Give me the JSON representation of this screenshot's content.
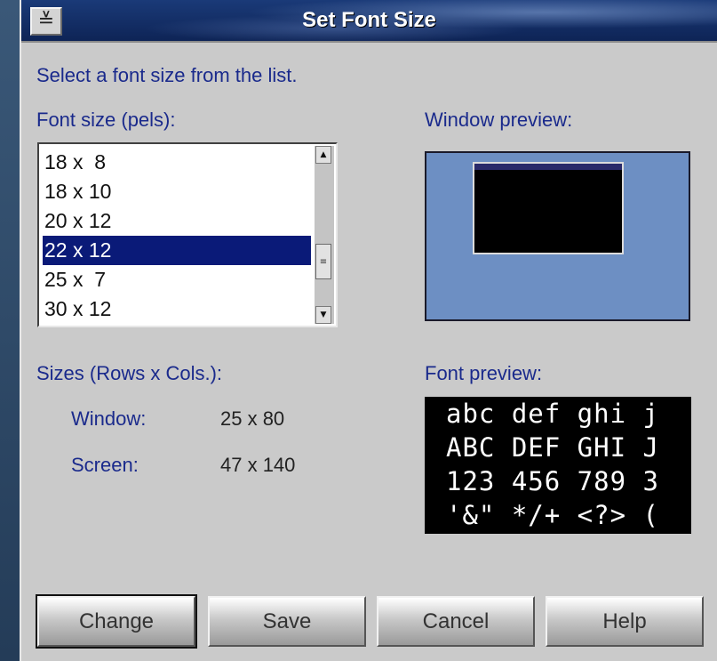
{
  "window": {
    "title": "Set Font Size",
    "sysmenu_glyph": "≚"
  },
  "instruction": "Select a font size from the list.",
  "font_size": {
    "label": "Font size (pels):",
    "items": [
      "18 x  8",
      "18 x 10",
      "20 x 12",
      "22 x 12",
      "25 x  7",
      "30 x 12"
    ],
    "selected": "22 x 12"
  },
  "window_preview": {
    "label": "Window preview:",
    "background_color": "#6d8fc3"
  },
  "sizes": {
    "label": "Sizes (Rows x Cols.):",
    "window_label": "Window:",
    "window_value": "25 x 80",
    "screen_label": "Screen:",
    "screen_value": "47 x 140"
  },
  "font_preview": {
    "label": "Font preview:",
    "lines": [
      "abc def ghi j",
      "ABC DEF GHI J",
      "123 456 789 3",
      "'&\" */+ <?> ("
    ]
  },
  "buttons": {
    "change": "Change",
    "save": "Save",
    "cancel": "Cancel",
    "help": "Help"
  },
  "colors": {
    "label_text": "#1a2a8c",
    "selection": "#0a1a78",
    "titlebar": "#12306a"
  }
}
